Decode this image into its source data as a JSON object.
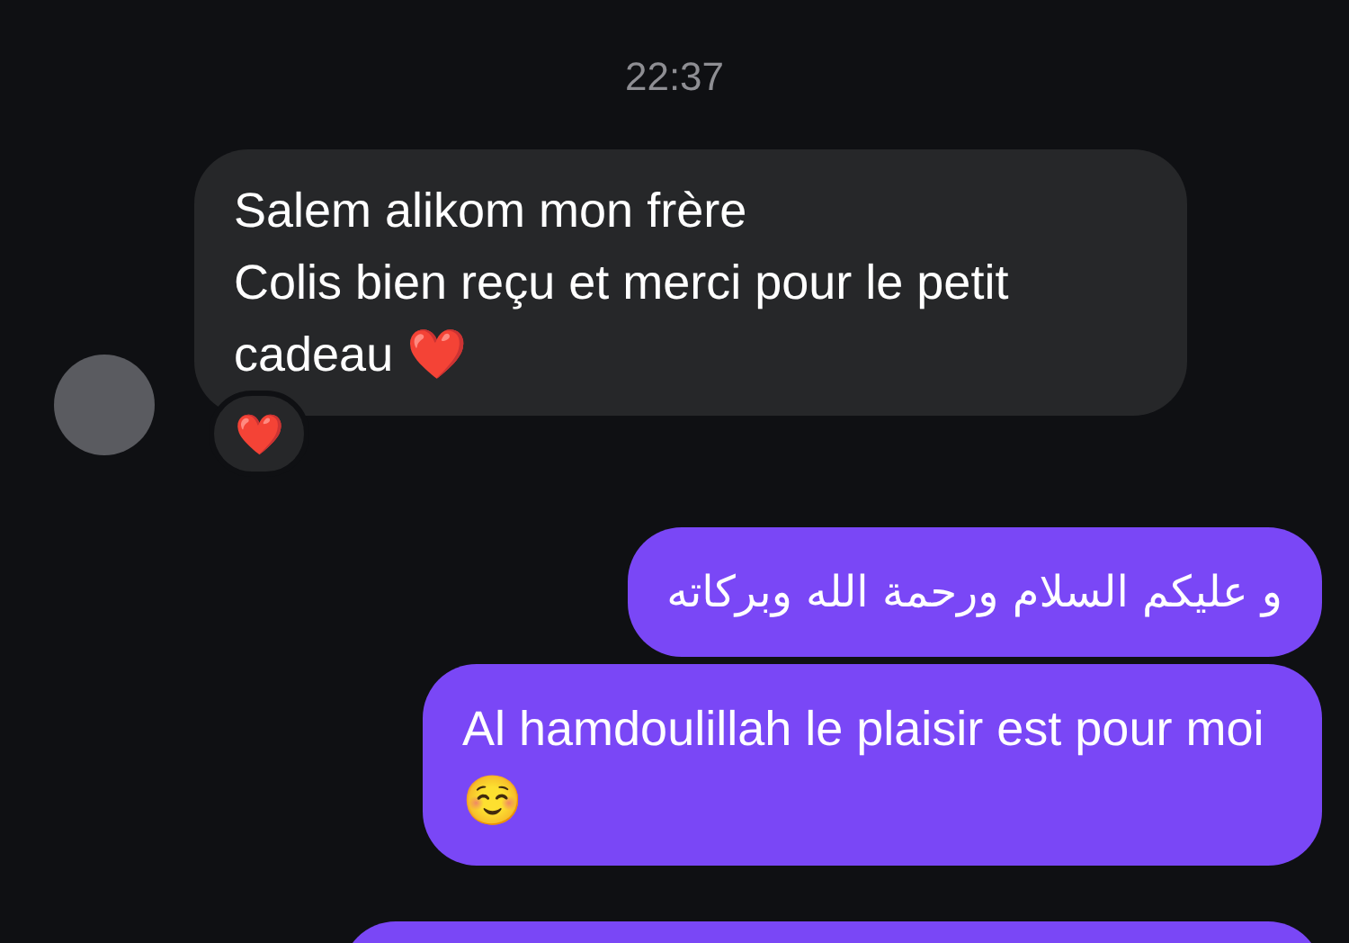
{
  "timestamp": "22:37",
  "messages": [
    {
      "kind": "incoming",
      "lines": [
        "Salem alikom mon frère",
        "Colis bien reçu et merci pour le petit cadeau ❤️"
      ],
      "reaction": "❤️"
    },
    {
      "kind": "outgoing",
      "lines": [
        "و عليكم السلام ورحمة الله وبركاته"
      ]
    },
    {
      "kind": "outgoing",
      "lines": [
        "Al hamdoulillah le plaisir est pour moi ☺️"
      ]
    },
    {
      "kind": "outgoing"
    }
  ]
}
